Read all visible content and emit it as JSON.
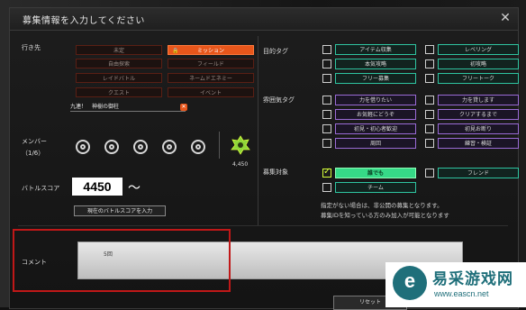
{
  "dialog": {
    "title": "募集情報を入力してください",
    "close_glyph": "✕"
  },
  "destination": {
    "label": "行き先",
    "options": [
      "未定",
      "ミッション",
      "自由探索",
      "フィールド",
      "レイドバトル",
      "ネームドエネミー",
      "クエスト",
      "イベント"
    ],
    "selected": "ミッション",
    "mission_name": "九連！　神樹の御柱",
    "clear_glyph": "✕"
  },
  "members": {
    "label_line1": "メンバー",
    "label_line2": "（1/6）",
    "monster_value": "4,450"
  },
  "battle_score": {
    "label": "バトルスコア",
    "value": "4450",
    "suffix": "〜",
    "apply_button": "現在のバトルスコアを入力"
  },
  "purpose_tags": {
    "label": "目的タグ",
    "items": [
      {
        "label": "アイテム収集",
        "checked": false
      },
      {
        "label": "レベリング",
        "checked": false
      },
      {
        "label": "本気攻略",
        "checked": false
      },
      {
        "label": "初攻略",
        "checked": false
      },
      {
        "label": "フリー募集",
        "checked": false
      },
      {
        "label": "フリートーク",
        "checked": false
      }
    ]
  },
  "mood_tags": {
    "label": "雰囲気タグ",
    "items": [
      {
        "label": "力を借りたい",
        "checked": false
      },
      {
        "label": "力を貸します",
        "checked": false
      },
      {
        "label": "お気軽にどうぞ",
        "checked": false
      },
      {
        "label": "クリアするまで",
        "checked": false
      },
      {
        "label": "初見・初心者歓迎",
        "checked": false
      },
      {
        "label": "初見お断り",
        "checked": false
      },
      {
        "label": "周回",
        "checked": false
      },
      {
        "label": "練習・検証",
        "checked": false
      }
    ]
  },
  "recruit_target": {
    "label": "募集対象",
    "items": [
      {
        "label": "誰でも",
        "checked": true
      },
      {
        "label": "フレンド",
        "checked": false
      },
      {
        "label": "チーム",
        "checked": false
      }
    ],
    "note_line1": "指定がない場合は、非公開の募集となります。",
    "note_line2": "募集IDを知っている方のみ加入が可能となります"
  },
  "comment": {
    "label": "コメント",
    "value": "5回"
  },
  "footer": {
    "reset_button": "リセット"
  },
  "watermark": {
    "logo_glyph": "e",
    "text": "易采游戏网",
    "url": "www.eascn.net"
  },
  "colors": {
    "accent_orange": "#e8561b",
    "tag_teal": "#2ec4a0",
    "mood_purple": "#9a6bd6",
    "selected_green": "#36d987",
    "highlight_red": "#c01818"
  }
}
